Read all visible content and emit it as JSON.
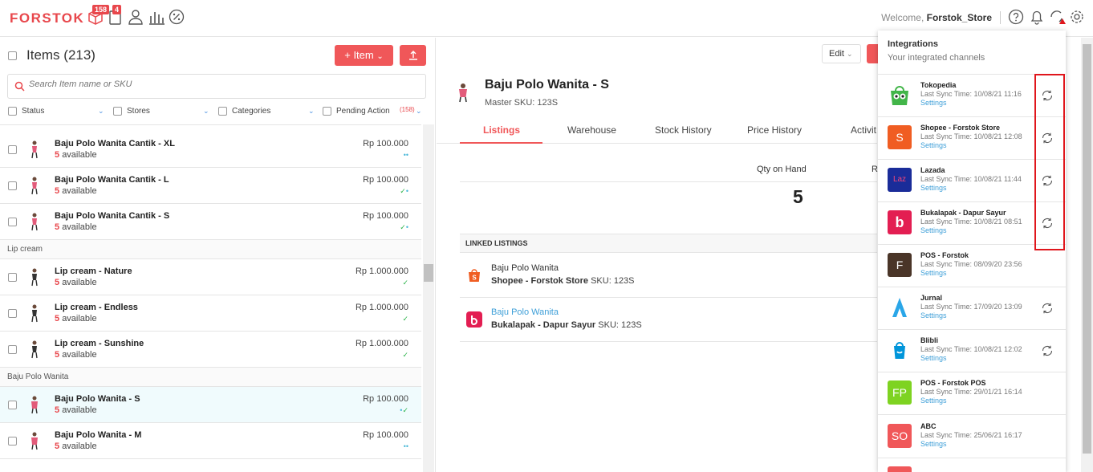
{
  "app": {
    "logo": "FORSTOK",
    "badge_a": "158",
    "badge_b": "4",
    "welcome_prefix": "Welcome,",
    "store_name": "Forstok_Store"
  },
  "items_panel": {
    "title": "Items (213)",
    "add_button": "+ Item",
    "search_placeholder": "Search Item name or SKU",
    "filters": {
      "status": "Status",
      "stores": "Stores",
      "categories": "Categories",
      "pending": "Pending Action",
      "pending_count": "(158)"
    },
    "groups": [
      {
        "label": "Lip cream"
      },
      {
        "label": "Baju Polo Wanita"
      }
    ],
    "rows": [
      {
        "name": "Baju Polo Wanita Cantik - XL",
        "qty": "5",
        "avail": "available",
        "price": "Rp 100.000"
      },
      {
        "name": "Baju Polo Wanita Cantik - L",
        "qty": "5",
        "avail": "available",
        "price": "Rp 100.000"
      },
      {
        "name": "Baju Polo Wanita Cantik - S",
        "qty": "5",
        "avail": "available",
        "price": "Rp 100.000"
      },
      {
        "name": "Lip cream - Nature",
        "qty": "5",
        "avail": "available",
        "price": "Rp 1.000.000"
      },
      {
        "name": "Lip cream - Endless",
        "qty": "5",
        "avail": "available",
        "price": "Rp 1.000.000"
      },
      {
        "name": "Lip cream - Sunshine",
        "qty": "5",
        "avail": "available",
        "price": "Rp 1.000.000"
      },
      {
        "name": "Baju Polo Wanita - S",
        "qty": "5",
        "avail": "available",
        "price": "Rp 100.000"
      },
      {
        "name": "Baju Polo Wanita - M",
        "qty": "5",
        "avail": "available",
        "price": "Rp 100.000"
      }
    ]
  },
  "detail": {
    "edit_button": "Edit",
    "title": "Baju Polo Wanita - S",
    "sku": "Master SKU: 123S",
    "tabs": [
      "Listings",
      "Warehouse",
      "Stock History",
      "Price History",
      "Activit"
    ],
    "qty_label": "Qty on Hand",
    "qty_label2": "R",
    "qty_value": "5",
    "linked_header": "LINKED LISTINGS",
    "linked": [
      {
        "name": "Baju Polo Wanita",
        "store": "Shopee - Forstok Store",
        "sku": "SKU: 123S"
      },
      {
        "name": "Baju Polo Wanita",
        "store": "Bukalapak - Dapur Sayur",
        "sku": "SKU: 123S"
      }
    ]
  },
  "integrations": {
    "title": "Integrations",
    "subtitle": "Your integrated channels",
    "settings_label": "Settings",
    "channels": [
      {
        "name": "Tokopedia",
        "sync": "Last Sync Time: 10/08/21 11:16",
        "icon": "tokopedia-icon",
        "color": "#ffffff",
        "letter": ""
      },
      {
        "name": "Shopee - Forstok Store",
        "sync": "Last Sync Time: 10/08/21 12:08",
        "icon": "shopee-icon",
        "color": "#f05d22",
        "letter": "S"
      },
      {
        "name": "Lazada",
        "sync": "Last Sync Time: 10/08/21 11:44",
        "icon": "lazada-icon",
        "color": "#1a2c99",
        "letter": "Laz"
      },
      {
        "name": "Bukalapak - Dapur Sayur",
        "sync": "Last Sync Time: 10/08/21 08:51",
        "icon": "bukalapak-icon",
        "color": "#e31e52",
        "letter": "b"
      },
      {
        "name": "POS - Forstok",
        "sync": "Last Sync Time: 08/09/20 23:56",
        "icon": "pos-forstok-icon",
        "color": "#4a3528",
        "letter": "F"
      },
      {
        "name": "Jurnal",
        "sync": "Last Sync Time: 17/09/20 13:09",
        "icon": "jurnal-icon",
        "color": "#ffffff",
        "letter": ""
      },
      {
        "name": "Blibli",
        "sync": "Last Sync Time: 10/08/21 12:02",
        "icon": "blibli-icon",
        "color": "#ffffff",
        "letter": ""
      },
      {
        "name": "POS - Forstok POS",
        "sync": "Last Sync Time: 29/01/21 16:14",
        "icon": "pos-fp-icon",
        "color": "#7ed321",
        "letter": "FP"
      },
      {
        "name": "ABC",
        "sync": "Last Sync Time: 25/06/21 16:17",
        "icon": "abc-icon",
        "color": "#f05759",
        "letter": "SO"
      }
    ]
  }
}
